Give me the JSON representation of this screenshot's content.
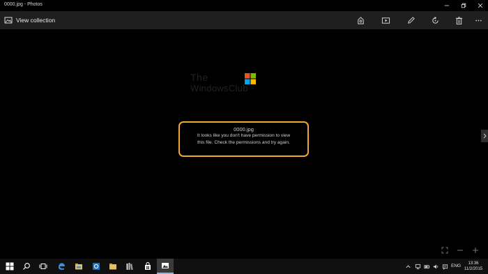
{
  "window": {
    "title": "0000.jpg - Photos",
    "controls": [
      "minimize-icon",
      "restore-icon",
      "close-icon"
    ]
  },
  "toolbar": {
    "view_collection_label": "View collection",
    "actions": [
      "share-icon",
      "slideshow-icon",
      "edit-pencil-icon",
      "rotate-icon",
      "delete-icon",
      "more-icon"
    ]
  },
  "watermark": {
    "line1": "The",
    "line2": "WindowsClub"
  },
  "error": {
    "filename": "0000.jpg",
    "line1": "It looks like you don't have permission to view",
    "line2": "this file. Check the permissions and try again."
  },
  "colors": {
    "highlight_border": "#f0a830",
    "toolbar_bg": "#1f1f1f",
    "viewer_bg": "#000000"
  },
  "taskbar": {
    "apps": [
      "start-icon",
      "search-icon",
      "task-view-icon",
      "edge-icon",
      "file-explorer-icon",
      "settings-icon",
      "folder-icon",
      "books-icon",
      "store-icon",
      "photos-icon"
    ],
    "active_app": "photos-icon",
    "tray": [
      "chevron-up-icon",
      "network-icon",
      "battery-icon",
      "volume-icon",
      "action-center-icon"
    ],
    "language": "ENG",
    "time": "13:36",
    "date": "11/2/2015"
  }
}
